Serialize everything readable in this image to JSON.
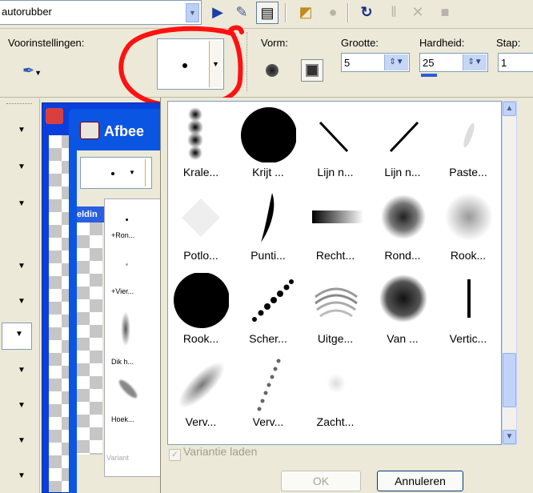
{
  "toolbar": {
    "tool_combo_value": "autorubber",
    "icons": [
      "arrow-icon",
      "script-icon",
      "palette-icon",
      "open-icon",
      "stop-icon",
      "refresh-icon",
      "pause-icon",
      "close-icon",
      "stop-square-icon"
    ]
  },
  "tool_options": {
    "presets_label": "Voorinstellingen:",
    "shape_label": "Vorm:",
    "size_label": "Grootte:",
    "size_value": "5",
    "hardness_label": "Hardheid:",
    "hardness_value": "25",
    "step_label": "Stap:",
    "step_value": "1",
    "annotation_color": "#ff0000"
  },
  "background_window": {
    "title": "Afbee",
    "side_label": "eldin",
    "mini_items": [
      "+Ron...",
      "+Vier...",
      "Dik h...",
      "Hoek..."
    ],
    "mini_variant_label": "Variant"
  },
  "brush_picker": {
    "brushes": [
      {
        "label": "Krale...",
        "icon": "beads-brush-icon"
      },
      {
        "label": "Krijt ...",
        "icon": "chalk-brush-icon"
      },
      {
        "label": "Lijn n...",
        "icon": "line-down-brush-icon"
      },
      {
        "label": "Lijn n...",
        "icon": "line-up-brush-icon"
      },
      {
        "label": "Paste...",
        "icon": "pastel-brush-icon"
      },
      {
        "label": "Potlo...",
        "icon": "pencil-brush-icon"
      },
      {
        "label": "Punti...",
        "icon": "pointed-brush-icon"
      },
      {
        "label": "Recht...",
        "icon": "rect-brush-icon"
      },
      {
        "label": "Rond...",
        "icon": "round-textured-brush-icon"
      },
      {
        "label": "Rook...",
        "icon": "smoke-soft-brush-icon"
      },
      {
        "label": "Rook...",
        "icon": "smoke-hard-brush-icon"
      },
      {
        "label": "Scher...",
        "icon": "sharp-dots-brush-icon"
      },
      {
        "label": "Uitge...",
        "icon": "ripple-brush-icon"
      },
      {
        "label": "Van ...",
        "icon": "splatter-brush-icon"
      },
      {
        "label": "Vertic...",
        "icon": "vertical-line-brush-icon"
      },
      {
        "label": "Verv...",
        "icon": "diagonal-soft-brush-icon"
      },
      {
        "label": "Verv...",
        "icon": "dotted-diagonal-brush-icon"
      },
      {
        "label": "Zacht...",
        "icon": "soft-dot-brush-icon"
      }
    ],
    "variant_label": "Variantie laden",
    "ok_label": "OK",
    "cancel_label": "Annuleren"
  }
}
